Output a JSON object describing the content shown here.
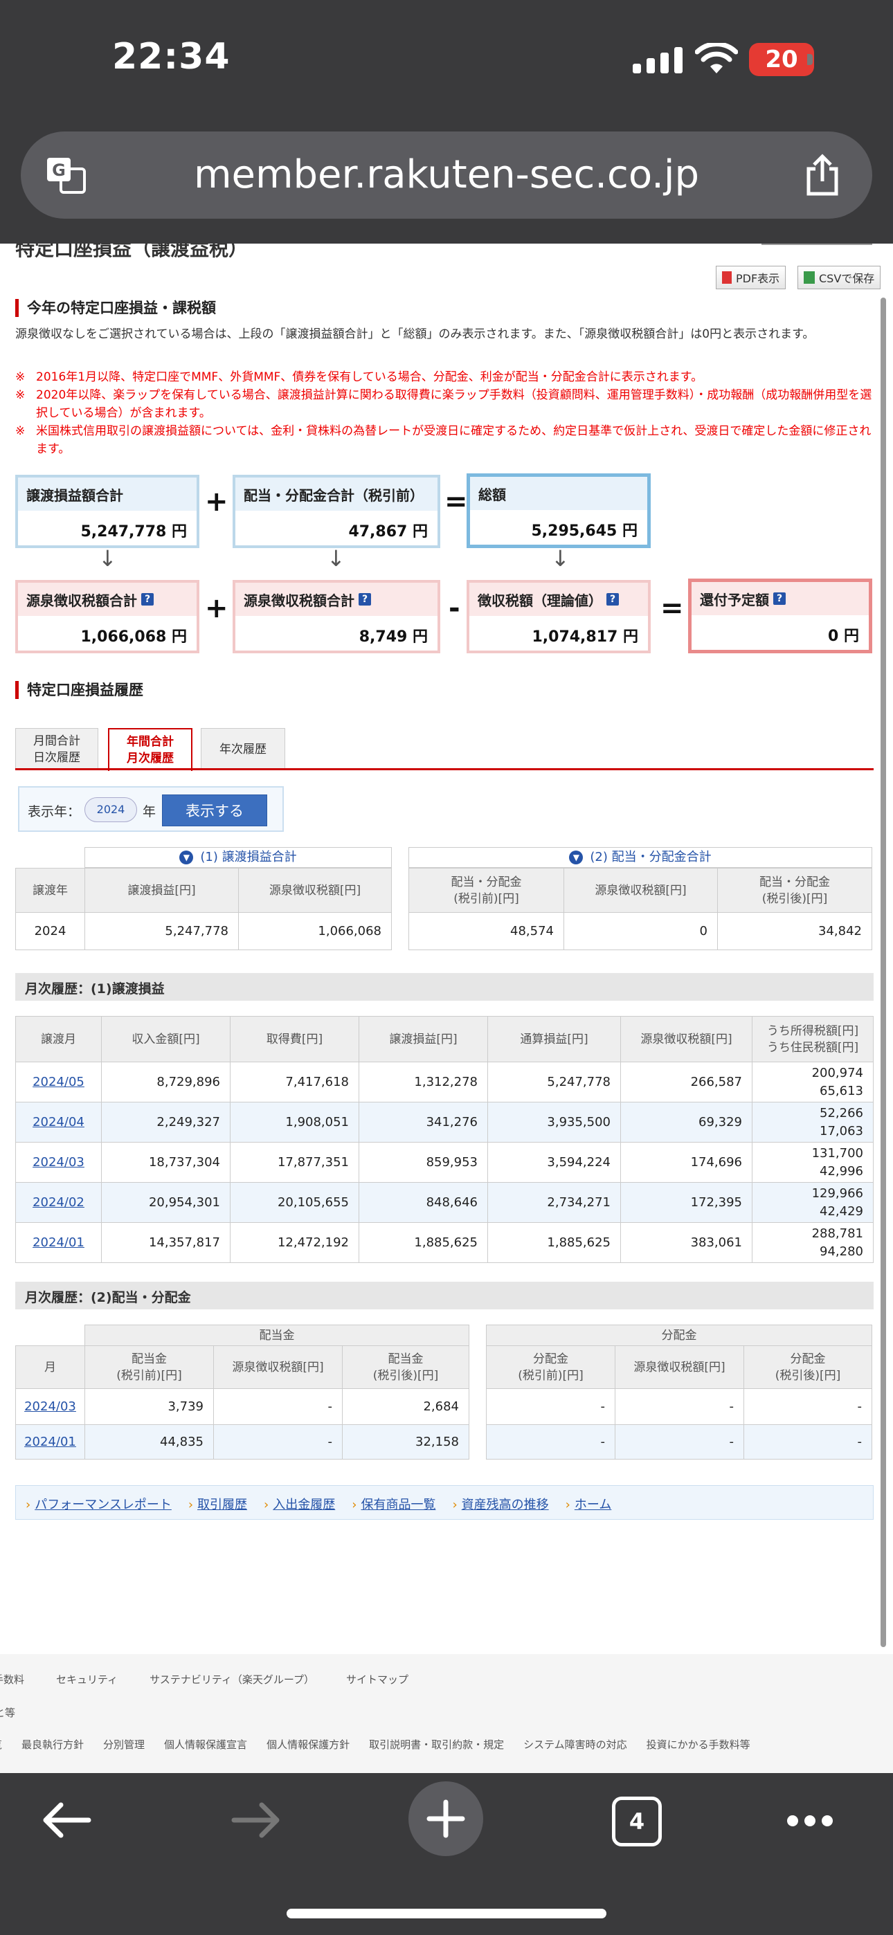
{
  "status_bar": {
    "time": "22:34",
    "battery": "20"
  },
  "browser": {
    "url": "member.rakuten-sec.co.jp",
    "tab_count": "4"
  },
  "page": {
    "cut_title": "特定口座損益（譲渡益税）",
    "pdf_label": "PDF表示",
    "csv_label": "CSVで保存",
    "section1_title": "今年の特定口座損益・課税額",
    "note": "源泉徴収なしをご選択されている場合は、上段の「譲渡損益額合計」と「総額」のみ表示されます。また、「源泉徴収税額合計」は0円と表示されます。",
    "red_notes": [
      "2016年1月以降、特定口座でMMF、外貨MMF、債券を保有している場合、分配金、利金が配当・分配金合計に表示されます。",
      "2020年以降、楽ラップを保有している場合、譲渡損益計算に関わる取得費に楽ラップ手数料（投資顧問料、運用管理手数料）・成功報酬（成功報酬併用型を選択している場合）が含まれます。",
      "米国株式信用取引の譲渡損益額については、金利・貸株料の為替レートが受渡日に確定するため、約定日基準で仮計上され、受渡日で確定した金額に修正されます。"
    ],
    "red_mark": "※",
    "summary": {
      "transfer_total_label": "譲渡損益額合計",
      "transfer_total": "5,247,778 円",
      "dividend_total_label": "配当・分配金合計（税引前）",
      "dividend_total": "47,867 円",
      "grand_total_label": "総額",
      "grand_total": "5,295,645 円",
      "withholding1_label": "源泉徴収税額合計",
      "withholding1": "1,066,068 円",
      "withholding2_label": "源泉徴収税額合計",
      "withholding2": "8,749 円",
      "theory_label": "徴収税額（理論値）",
      "theory": "1,074,817 円",
      "refund_label": "還付予定額",
      "refund": "0 円",
      "plus": "+",
      "minus": "-",
      "equals": "=",
      "down": "↓",
      "help": "?"
    },
    "section2_title": "特定口座損益履歴",
    "tabs": [
      {
        "line1": "月間合計",
        "line2": "日次履歴"
      },
      {
        "line1": "年間合計",
        "line2": "月次履歴"
      },
      {
        "line1": "年次履歴",
        "line2": ""
      }
    ],
    "year_select": {
      "label": "表示年：",
      "value": "2024",
      "unit": "年",
      "button": "表示する"
    },
    "annual": {
      "cap1": "(1) 譲渡損益合計",
      "cap2": "(2) 配当・分配金合計",
      "cap_icon": "▼",
      "headers": [
        "譲渡年",
        "譲渡損益[円]",
        "源泉徴収税額[円]",
        "配当・分配金\n(税引前)[円]",
        "源泉徴収税額[円]",
        "配当・分配金\n(税引後)[円]"
      ],
      "row": [
        "2024",
        "5,247,778",
        "1,066,068",
        "48,574",
        "0",
        "34,842"
      ]
    },
    "monthly1": {
      "title": "月次履歴：(1)譲渡損益",
      "headers": [
        "譲渡月",
        "収入金額[円]",
        "取得費[円]",
        "譲渡損益[円]",
        "通算損益[円]",
        "源泉徴収税額[円]",
        "うち所得税額[円]\nうち住民税額[円]"
      ],
      "rows": [
        [
          "2024/05",
          "8,729,896",
          "7,417,618",
          "1,312,278",
          "5,247,778",
          "266,587",
          "200,974",
          "65,613"
        ],
        [
          "2024/04",
          "2,249,327",
          "1,908,051",
          "341,276",
          "3,935,500",
          "69,329",
          "52,266",
          "17,063"
        ],
        [
          "2024/03",
          "18,737,304",
          "17,877,351",
          "859,953",
          "3,594,224",
          "174,696",
          "131,700",
          "42,996"
        ],
        [
          "2024/02",
          "20,954,301",
          "20,105,655",
          "848,646",
          "2,734,271",
          "172,395",
          "129,966",
          "42,429"
        ],
        [
          "2024/01",
          "14,357,817",
          "12,472,192",
          "1,885,625",
          "1,885,625",
          "383,061",
          "288,781",
          "94,280"
        ]
      ]
    },
    "monthly2": {
      "title": "月次履歴：(2)配当・分配金",
      "group1": "配当金",
      "group2": "分配金",
      "headers": [
        "月",
        "配当金\n(税引前)[円]",
        "源泉徴収税額[円]",
        "配当金\n(税引後)[円]",
        "分配金\n(税引前)[円]",
        "源泉徴収税額[円]",
        "分配金\n(税引後)[円]"
      ],
      "rows": [
        [
          "2024/03",
          "3,739",
          "-",
          "2,684",
          "-",
          "-",
          "-"
        ],
        [
          "2024/01",
          "44,835",
          "-",
          "32,158",
          "-",
          "-",
          "-"
        ]
      ]
    },
    "links": [
      "パフォーマンスレポート",
      "取引履歴",
      "入出金履歴",
      "保有商品一覧",
      "資産残高の推移",
      "ホーム"
    ],
    "footer_row1": [
      "手数料",
      "セキュリティ",
      "サステナビリティ（楽天グループ）",
      "サイトマップ"
    ],
    "footer_mid": "と等",
    "footer_row2": [
      "覧",
      "最良執行方針",
      "分別管理",
      "個人情報保護宣言",
      "個人情報保護方針",
      "取引説明書・取引約款・規定",
      "システム障害時の対応",
      "投資にかかる手数料等"
    ]
  }
}
